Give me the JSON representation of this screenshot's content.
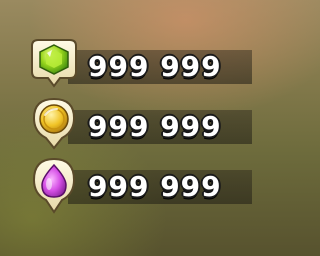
{
  "resources": [
    {
      "type": "gems",
      "icon": "gem-icon",
      "amount": "999 999",
      "color": "#8fd11e"
    },
    {
      "type": "gold",
      "icon": "gold-coin-icon",
      "amount": "999 999",
      "color": "#f0c325"
    },
    {
      "type": "elixir",
      "icon": "elixir-drop-icon",
      "amount": "999 999",
      "color": "#d651e6"
    }
  ]
}
